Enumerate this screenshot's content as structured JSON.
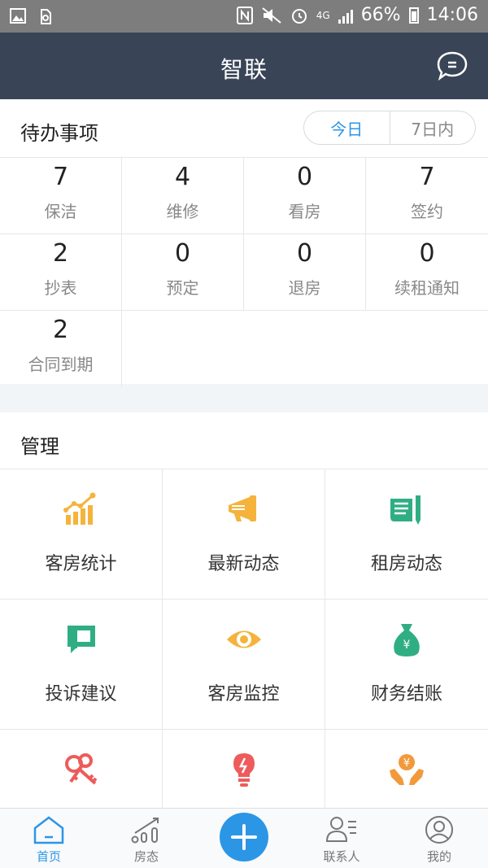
{
  "status_bar": {
    "battery": "66%",
    "time": "14:06",
    "network": "4G"
  },
  "header": {
    "title": "智联"
  },
  "todo": {
    "title": "待办事项",
    "tabs": [
      "今日",
      "7日内"
    ],
    "items": [
      {
        "count": "7",
        "label": "保洁"
      },
      {
        "count": "4",
        "label": "维修"
      },
      {
        "count": "0",
        "label": "看房"
      },
      {
        "count": "7",
        "label": "签约"
      },
      {
        "count": "2",
        "label": "抄表"
      },
      {
        "count": "0",
        "label": "预定"
      },
      {
        "count": "0",
        "label": "退房"
      },
      {
        "count": "0",
        "label": "续租通知"
      },
      {
        "count": "2",
        "label": "合同到期"
      }
    ]
  },
  "manage": {
    "title": "管理",
    "items": [
      {
        "label": "客房统计",
        "icon": "bar-chart-icon"
      },
      {
        "label": "最新动态",
        "icon": "megaphone-icon"
      },
      {
        "label": "租房动态",
        "icon": "document-pen-icon"
      },
      {
        "label": "投诉建议",
        "icon": "feedback-icon"
      },
      {
        "label": "客房监控",
        "icon": "eye-icon"
      },
      {
        "label": "财务结账",
        "icon": "money-bag-icon"
      },
      {
        "label": "",
        "icon": "keys-icon"
      },
      {
        "label": "",
        "icon": "lightbulb-icon"
      },
      {
        "label": "",
        "icon": "yen-hands-icon"
      }
    ]
  },
  "tabbar": {
    "home": "首页",
    "rooms": "房态",
    "contacts": "联系人",
    "mine": "我的"
  },
  "colors": {
    "header_bg": "#394457",
    "accent_blue": "#2b96e6",
    "icon_yellow": "#f5b33c",
    "icon_green": "#2fae84",
    "icon_red": "#ee5b5b",
    "icon_orange": "#f29a3b"
  }
}
